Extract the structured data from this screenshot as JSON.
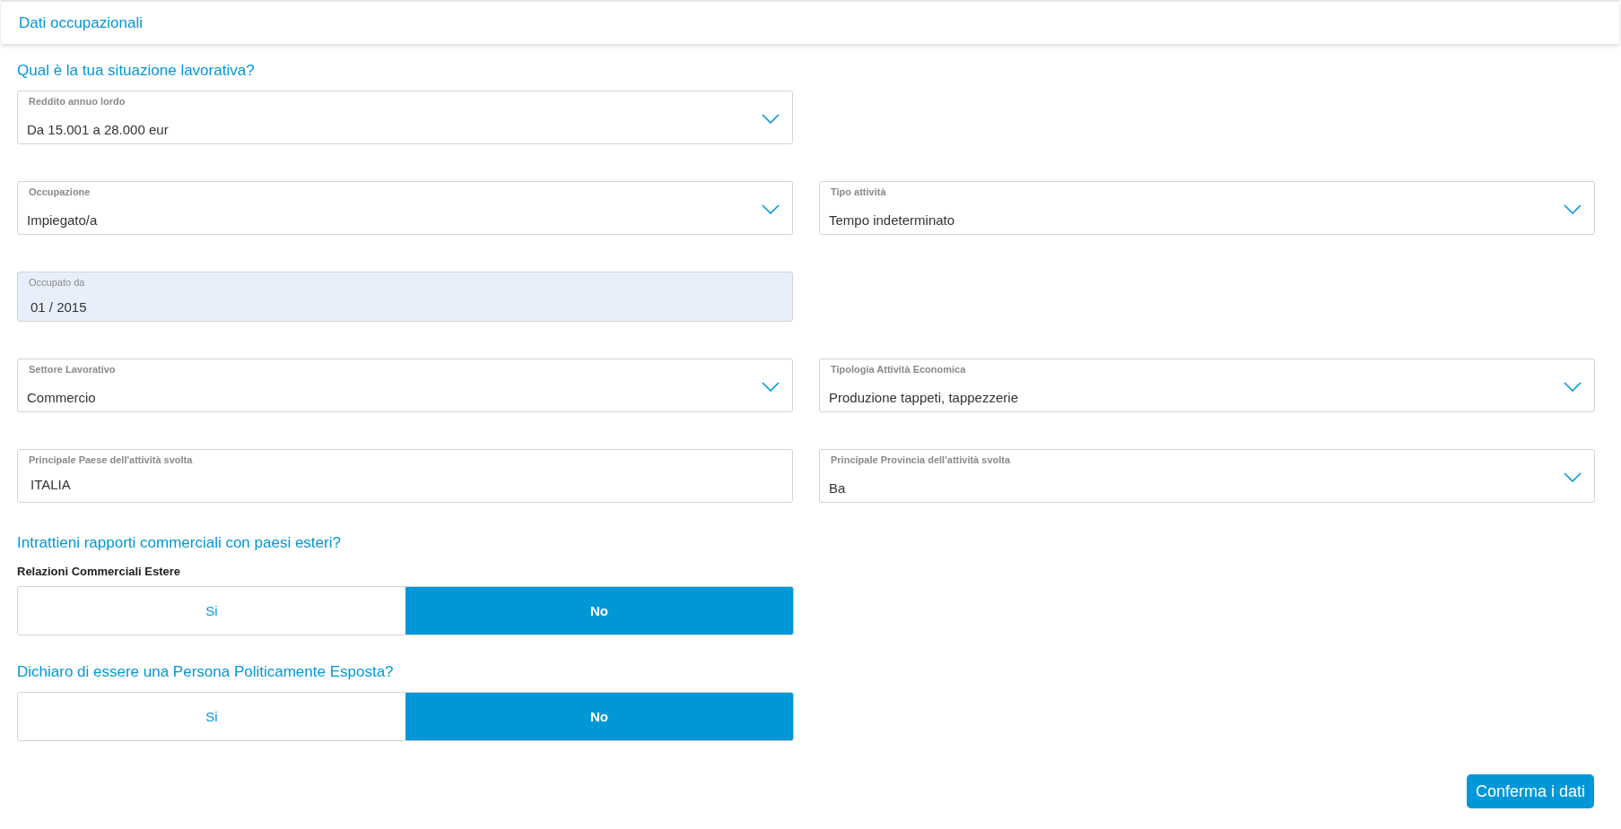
{
  "header": {
    "title": "Dati occupazionali"
  },
  "section_title": "Qual è la tua situazione lavorativa?",
  "field_rows": [
    {
      "fields": [
        {
          "kind": "select",
          "label": "Reddito annuo lordo",
          "value": "Da 15.001 a 28.000 eur"
        }
      ]
    },
    {
      "fields": [
        {
          "kind": "select",
          "label": "Occupazione",
          "value": "Impiegato/a"
        },
        {
          "kind": "select",
          "label": "Tipo attività",
          "value": "Tempo indeterminato"
        }
      ]
    },
    {
      "fields": [
        {
          "kind": "date",
          "label": "Occupato da",
          "value": "01 / 2015"
        }
      ]
    },
    {
      "fields": [
        {
          "kind": "select",
          "label": "Settore Lavorativo",
          "value": "Commercio"
        },
        {
          "kind": "select",
          "label": "Tipologia Attività Economica",
          "value": "Produzione tappeti, tappezzerie"
        }
      ]
    },
    {
      "fields": [
        {
          "kind": "text",
          "label": "Principale Paese dell'attività svolta",
          "value": "ITALIA"
        },
        {
          "kind": "select",
          "label": "Principale Provincia dell'attività svolta",
          "value": "Ba"
        }
      ]
    }
  ],
  "questions": [
    {
      "title": "Intrattieni rapporti commerciali con paesi esteri?",
      "label": "Relazioni Commerciali Estere",
      "options": [
        {
          "label": "Si",
          "selected": false
        },
        {
          "label": "No",
          "selected": true
        }
      ]
    },
    {
      "title": "Dichiaro di essere una Persona Politicamente Esposta?",
      "options": [
        {
          "label": "Si",
          "selected": false
        },
        {
          "label": "No",
          "selected": true
        }
      ]
    }
  ],
  "confirm_button": "Conferma i dati"
}
